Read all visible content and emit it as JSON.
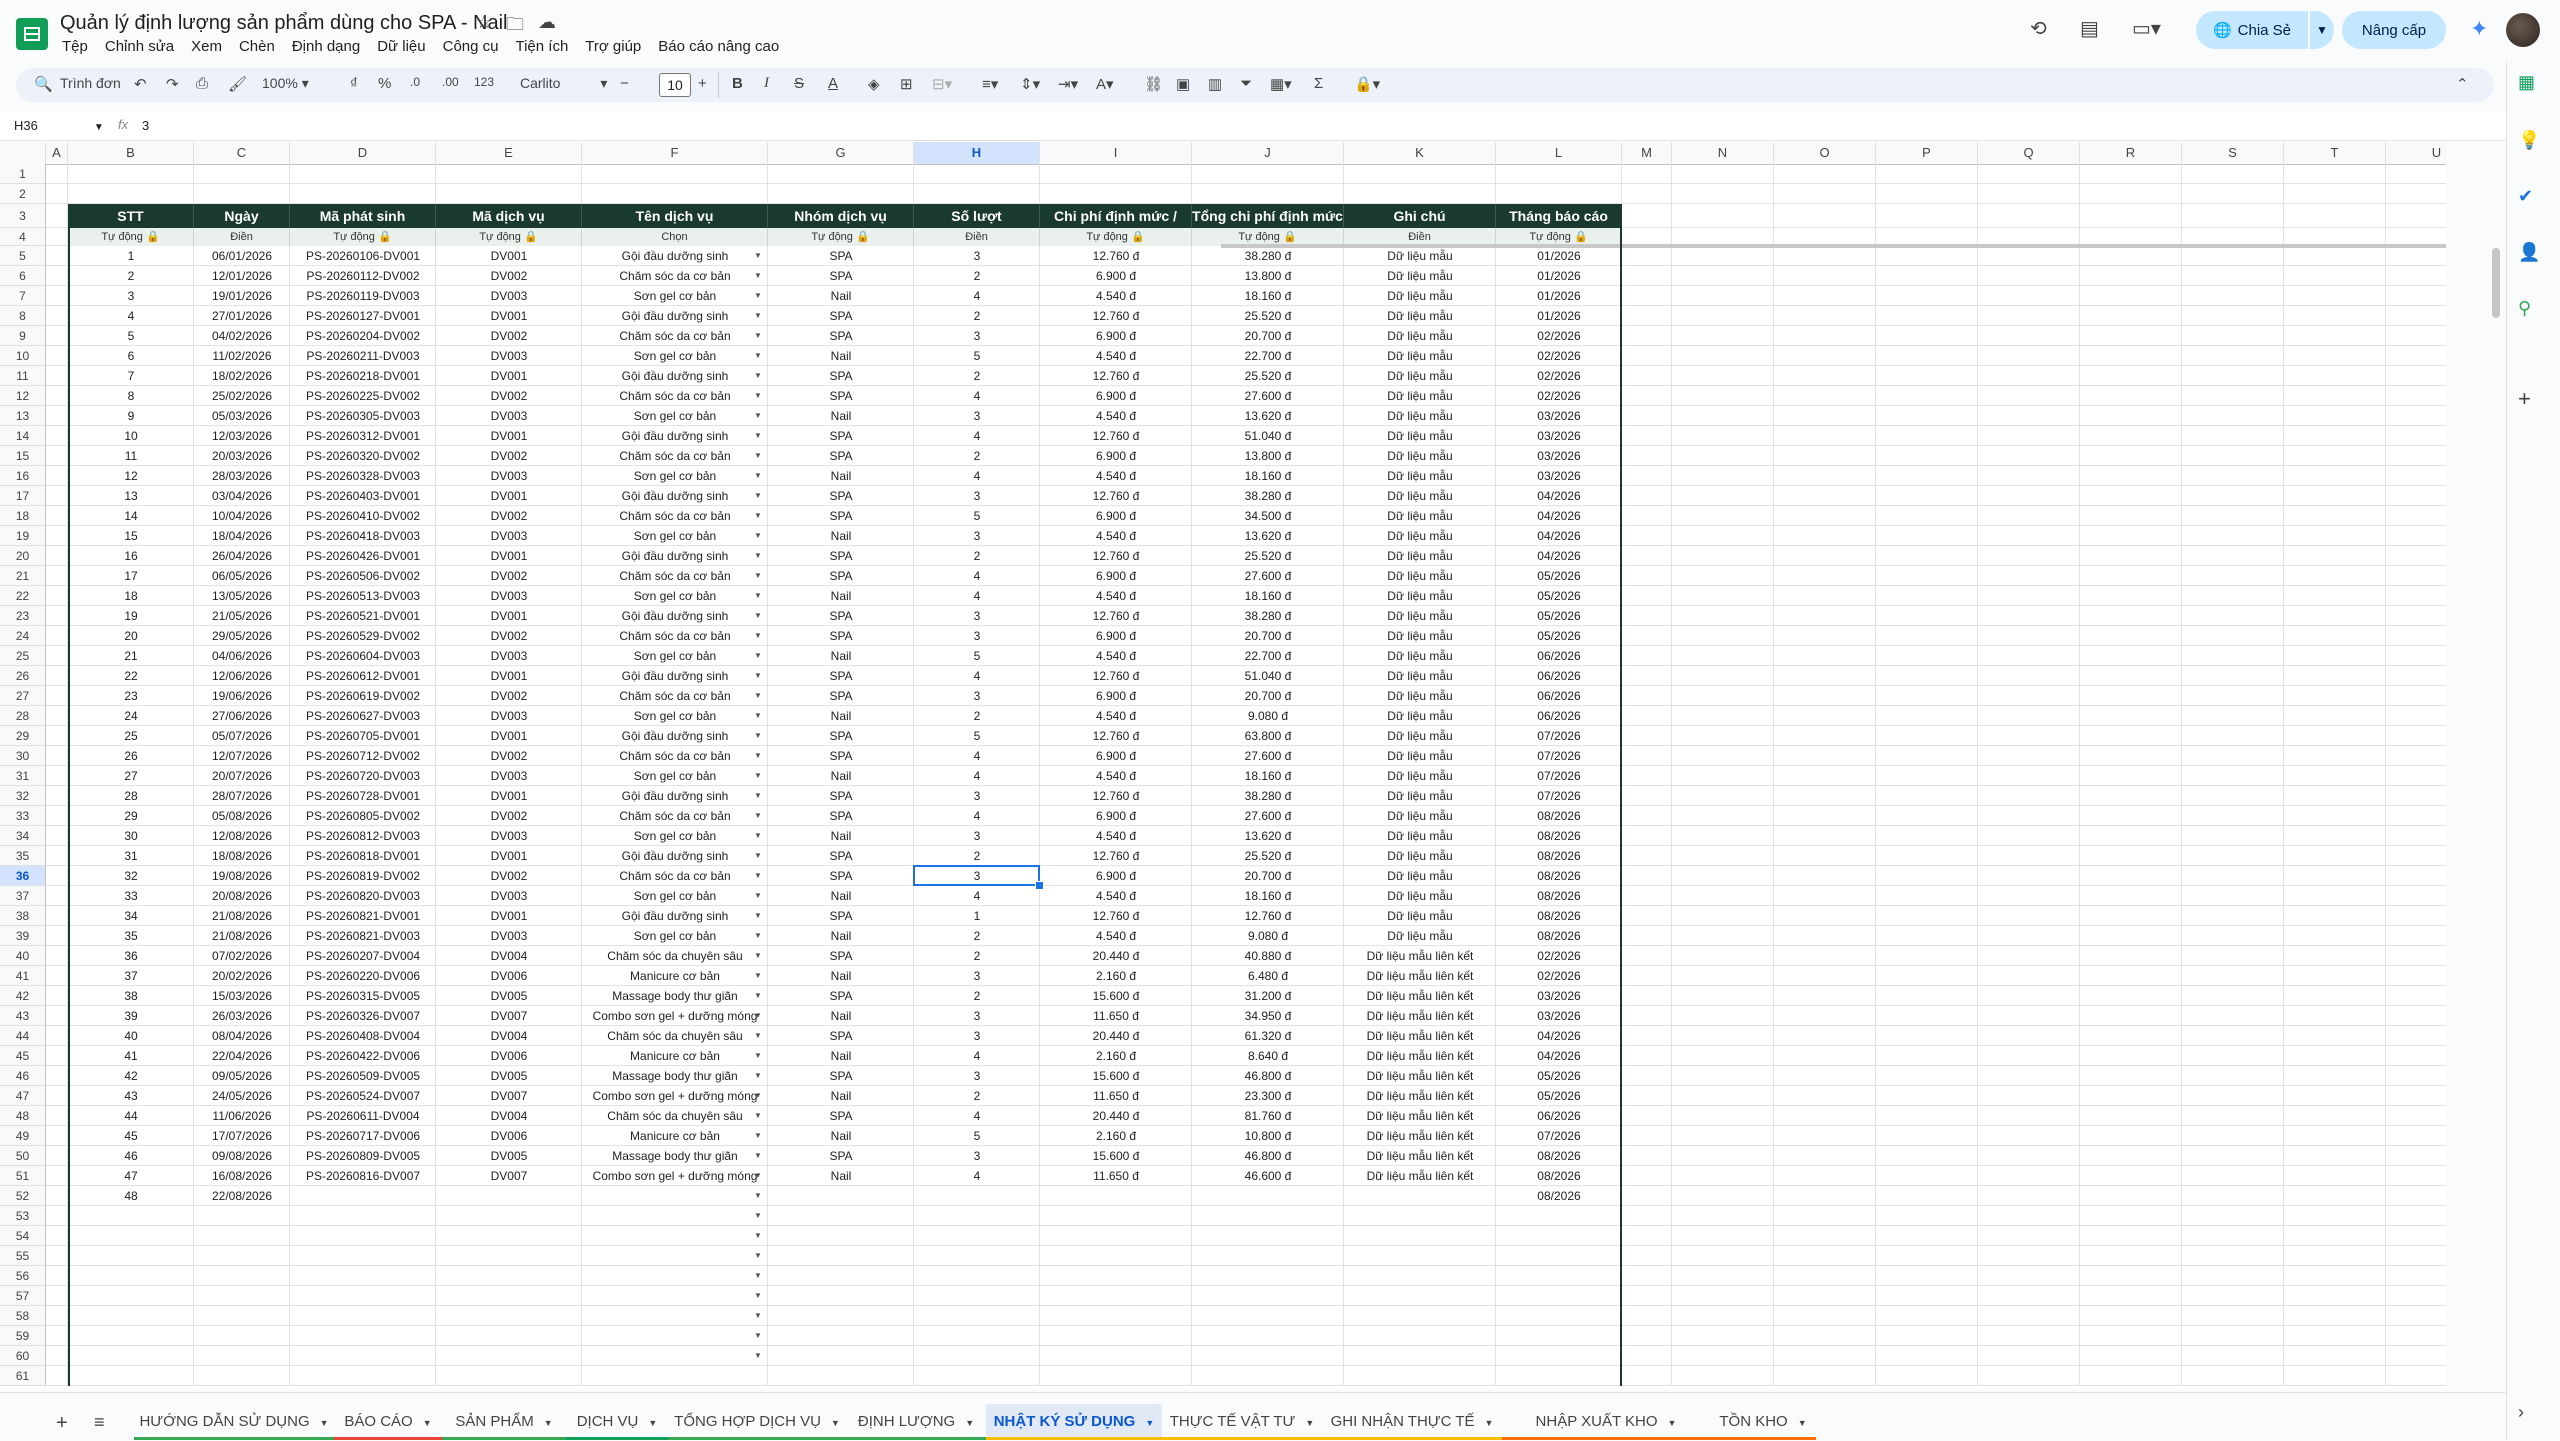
{
  "app": {
    "title": "Quản lý định lượng sản phẩm dùng cho SPA - Nail",
    "menus": [
      "Tệp",
      "Chỉnh sửa",
      "Xem",
      "Chèn",
      "Định dạng",
      "Dữ liệu",
      "Công cụ",
      "Tiện ích",
      "Trợ giúp",
      "Báo cáo nâng cao"
    ],
    "share_label": "Chia Sẻ",
    "upgrade_label": "Nâng cấp"
  },
  "toolbar": {
    "search_placeholder": "Trình đơn",
    "zoom": "100%",
    "currency": "₫",
    "percent": "%",
    "dec_minus": ".0",
    "dec_plus": ".00",
    "number_format": "123",
    "font": "Carlito",
    "font_size": "10"
  },
  "formula": {
    "cell_ref": "H36",
    "fx": "fx",
    "value": "3"
  },
  "columns": [
    "A",
    "B",
    "C",
    "D",
    "E",
    "F",
    "G",
    "H",
    "I",
    "J",
    "K",
    "L",
    "M",
    "N",
    "O",
    "P",
    "Q",
    "R",
    "S",
    "T",
    "U"
  ],
  "table": {
    "headers": [
      "STT",
      "Ngày",
      "Mã phát sinh",
      "Mã dịch vụ",
      "Tên dịch vụ",
      "Nhóm dịch vụ",
      "Số lượt",
      "Chi phí định mức / lượt",
      "Tổng chi phí định mức",
      "Ghi chú",
      "Tháng báo cáo"
    ],
    "subheaders": [
      "Tự động 🔒",
      "Điền",
      "Tự động 🔒",
      "Tự động 🔒",
      "Chọn",
      "Tự động 🔒",
      "Điền",
      "Tự động 🔒",
      "Tự động 🔒",
      "Điền",
      "Tự động 🔒"
    ],
    "rows": [
      [
        "1",
        "06/01/2026",
        "PS-20260106-DV001",
        "DV001",
        "Gội đầu dưỡng sinh",
        "SPA",
        "3",
        "12.760 đ",
        "38.280 đ",
        "Dữ liệu mẫu",
        "01/2026"
      ],
      [
        "2",
        "12/01/2026",
        "PS-20260112-DV002",
        "DV002",
        "Chăm sóc da cơ bản",
        "SPA",
        "2",
        "6.900 đ",
        "13.800 đ",
        "Dữ liệu mẫu",
        "01/2026"
      ],
      [
        "3",
        "19/01/2026",
        "PS-20260119-DV003",
        "DV003",
        "Sơn gel cơ bản",
        "Nail",
        "4",
        "4.540 đ",
        "18.160 đ",
        "Dữ liệu mẫu",
        "01/2026"
      ],
      [
        "4",
        "27/01/2026",
        "PS-20260127-DV001",
        "DV001",
        "Gội đầu dưỡng sinh",
        "SPA",
        "2",
        "12.760 đ",
        "25.520 đ",
        "Dữ liệu mẫu",
        "01/2026"
      ],
      [
        "5",
        "04/02/2026",
        "PS-20260204-DV002",
        "DV002",
        "Chăm sóc da cơ bản",
        "SPA",
        "3",
        "6.900 đ",
        "20.700 đ",
        "Dữ liệu mẫu",
        "02/2026"
      ],
      [
        "6",
        "11/02/2026",
        "PS-20260211-DV003",
        "DV003",
        "Sơn gel cơ bản",
        "Nail",
        "5",
        "4.540 đ",
        "22.700 đ",
        "Dữ liệu mẫu",
        "02/2026"
      ],
      [
        "7",
        "18/02/2026",
        "PS-20260218-DV001",
        "DV001",
        "Gội đầu dưỡng sinh",
        "SPA",
        "2",
        "12.760 đ",
        "25.520 đ",
        "Dữ liệu mẫu",
        "02/2026"
      ],
      [
        "8",
        "25/02/2026",
        "PS-20260225-DV002",
        "DV002",
        "Chăm sóc da cơ bản",
        "SPA",
        "4",
        "6.900 đ",
        "27.600 đ",
        "Dữ liệu mẫu",
        "02/2026"
      ],
      [
        "9",
        "05/03/2026",
        "PS-20260305-DV003",
        "DV003",
        "Sơn gel cơ bản",
        "Nail",
        "3",
        "4.540 đ",
        "13.620 đ",
        "Dữ liệu mẫu",
        "03/2026"
      ],
      [
        "10",
        "12/03/2026",
        "PS-20260312-DV001",
        "DV001",
        "Gội đầu dưỡng sinh",
        "SPA",
        "4",
        "12.760 đ",
        "51.040 đ",
        "Dữ liệu mẫu",
        "03/2026"
      ],
      [
        "11",
        "20/03/2026",
        "PS-20260320-DV002",
        "DV002",
        "Chăm sóc da cơ bản",
        "SPA",
        "2",
        "6.900 đ",
        "13.800 đ",
        "Dữ liệu mẫu",
        "03/2026"
      ],
      [
        "12",
        "28/03/2026",
        "PS-20260328-DV003",
        "DV003",
        "Sơn gel cơ bản",
        "Nail",
        "4",
        "4.540 đ",
        "18.160 đ",
        "Dữ liệu mẫu",
        "03/2026"
      ],
      [
        "13",
        "03/04/2026",
        "PS-20260403-DV001",
        "DV001",
        "Gội đầu dưỡng sinh",
        "SPA",
        "3",
        "12.760 đ",
        "38.280 đ",
        "Dữ liệu mẫu",
        "04/2026"
      ],
      [
        "14",
        "10/04/2026",
        "PS-20260410-DV002",
        "DV002",
        "Chăm sóc da cơ bản",
        "SPA",
        "5",
        "6.900 đ",
        "34.500 đ",
        "Dữ liệu mẫu",
        "04/2026"
      ],
      [
        "15",
        "18/04/2026",
        "PS-20260418-DV003",
        "DV003",
        "Sơn gel cơ bản",
        "Nail",
        "3",
        "4.540 đ",
        "13.620 đ",
        "Dữ liệu mẫu",
        "04/2026"
      ],
      [
        "16",
        "26/04/2026",
        "PS-20260426-DV001",
        "DV001",
        "Gội đầu dưỡng sinh",
        "SPA",
        "2",
        "12.760 đ",
        "25.520 đ",
        "Dữ liệu mẫu",
        "04/2026"
      ],
      [
        "17",
        "06/05/2026",
        "PS-20260506-DV002",
        "DV002",
        "Chăm sóc da cơ bản",
        "SPA",
        "4",
        "6.900 đ",
        "27.600 đ",
        "Dữ liệu mẫu",
        "05/2026"
      ],
      [
        "18",
        "13/05/2026",
        "PS-20260513-DV003",
        "DV003",
        "Sơn gel cơ bản",
        "Nail",
        "4",
        "4.540 đ",
        "18.160 đ",
        "Dữ liệu mẫu",
        "05/2026"
      ],
      [
        "19",
        "21/05/2026",
        "PS-20260521-DV001",
        "DV001",
        "Gội đầu dưỡng sinh",
        "SPA",
        "3",
        "12.760 đ",
        "38.280 đ",
        "Dữ liệu mẫu",
        "05/2026"
      ],
      [
        "20",
        "29/05/2026",
        "PS-20260529-DV002",
        "DV002",
        "Chăm sóc da cơ bản",
        "SPA",
        "3",
        "6.900 đ",
        "20.700 đ",
        "Dữ liệu mẫu",
        "05/2026"
      ],
      [
        "21",
        "04/06/2026",
        "PS-20260604-DV003",
        "DV003",
        "Sơn gel cơ bản",
        "Nail",
        "5",
        "4.540 đ",
        "22.700 đ",
        "Dữ liệu mẫu",
        "06/2026"
      ],
      [
        "22",
        "12/06/2026",
        "PS-20260612-DV001",
        "DV001",
        "Gội đầu dưỡng sinh",
        "SPA",
        "4",
        "12.760 đ",
        "51.040 đ",
        "Dữ liệu mẫu",
        "06/2026"
      ],
      [
        "23",
        "19/06/2026",
        "PS-20260619-DV002",
        "DV002",
        "Chăm sóc da cơ bản",
        "SPA",
        "3",
        "6.900 đ",
        "20.700 đ",
        "Dữ liệu mẫu",
        "06/2026"
      ],
      [
        "24",
        "27/06/2026",
        "PS-20260627-DV003",
        "DV003",
        "Sơn gel cơ bản",
        "Nail",
        "2",
        "4.540 đ",
        "9.080 đ",
        "Dữ liệu mẫu",
        "06/2026"
      ],
      [
        "25",
        "05/07/2026",
        "PS-20260705-DV001",
        "DV001",
        "Gội đầu dưỡng sinh",
        "SPA",
        "5",
        "12.760 đ",
        "63.800 đ",
        "Dữ liệu mẫu",
        "07/2026"
      ],
      [
        "26",
        "12/07/2026",
        "PS-20260712-DV002",
        "DV002",
        "Chăm sóc da cơ bản",
        "SPA",
        "4",
        "6.900 đ",
        "27.600 đ",
        "Dữ liệu mẫu",
        "07/2026"
      ],
      [
        "27",
        "20/07/2026",
        "PS-20260720-DV003",
        "DV003",
        "Sơn gel cơ bản",
        "Nail",
        "4",
        "4.540 đ",
        "18.160 đ",
        "Dữ liệu mẫu",
        "07/2026"
      ],
      [
        "28",
        "28/07/2026",
        "PS-20260728-DV001",
        "DV001",
        "Gội đầu dưỡng sinh",
        "SPA",
        "3",
        "12.760 đ",
        "38.280 đ",
        "Dữ liệu mẫu",
        "07/2026"
      ],
      [
        "29",
        "05/08/2026",
        "PS-20260805-DV002",
        "DV002",
        "Chăm sóc da cơ bản",
        "SPA",
        "4",
        "6.900 đ",
        "27.600 đ",
        "Dữ liệu mẫu",
        "08/2026"
      ],
      [
        "30",
        "12/08/2026",
        "PS-20260812-DV003",
        "DV003",
        "Sơn gel cơ bản",
        "Nail",
        "3",
        "4.540 đ",
        "13.620 đ",
        "Dữ liệu mẫu",
        "08/2026"
      ],
      [
        "31",
        "18/08/2026",
        "PS-20260818-DV001",
        "DV001",
        "Gội đầu dưỡng sinh",
        "SPA",
        "2",
        "12.760 đ",
        "25.520 đ",
        "Dữ liệu mẫu",
        "08/2026"
      ],
      [
        "32",
        "19/08/2026",
        "PS-20260819-DV002",
        "DV002",
        "Chăm sóc da cơ bản",
        "SPA",
        "3",
        "6.900 đ",
        "20.700 đ",
        "Dữ liệu mẫu",
        "08/2026"
      ],
      [
        "33",
        "20/08/2026",
        "PS-20260820-DV003",
        "DV003",
        "Sơn gel cơ bản",
        "Nail",
        "4",
        "4.540 đ",
        "18.160 đ",
        "Dữ liệu mẫu",
        "08/2026"
      ],
      [
        "34",
        "21/08/2026",
        "PS-20260821-DV001",
        "DV001",
        "Gội đầu dưỡng sinh",
        "SPA",
        "1",
        "12.760 đ",
        "12.760 đ",
        "Dữ liệu mẫu",
        "08/2026"
      ],
      [
        "35",
        "21/08/2026",
        "PS-20260821-DV003",
        "DV003",
        "Sơn gel cơ bản",
        "Nail",
        "2",
        "4.540 đ",
        "9.080 đ",
        "Dữ liệu mẫu",
        "08/2026"
      ],
      [
        "36",
        "07/02/2026",
        "PS-20260207-DV004",
        "DV004",
        "Chăm sóc da chuyên sâu",
        "SPA",
        "2",
        "20.440 đ",
        "40.880 đ",
        "Dữ liệu mẫu liên kết",
        "02/2026"
      ],
      [
        "37",
        "20/02/2026",
        "PS-20260220-DV006",
        "DV006",
        "Manicure cơ bản",
        "Nail",
        "3",
        "2.160 đ",
        "6.480 đ",
        "Dữ liệu mẫu liên kết",
        "02/2026"
      ],
      [
        "38",
        "15/03/2026",
        "PS-20260315-DV005",
        "DV005",
        "Massage body thư giãn",
        "SPA",
        "2",
        "15.600 đ",
        "31.200 đ",
        "Dữ liệu mẫu liên kết",
        "03/2026"
      ],
      [
        "39",
        "26/03/2026",
        "PS-20260326-DV007",
        "DV007",
        "Combo sơn gel + dưỡng móng",
        "Nail",
        "3",
        "11.650 đ",
        "34.950 đ",
        "Dữ liệu mẫu liên kết",
        "03/2026"
      ],
      [
        "40",
        "08/04/2026",
        "PS-20260408-DV004",
        "DV004",
        "Chăm sóc da chuyên sâu",
        "SPA",
        "3",
        "20.440 đ",
        "61.320 đ",
        "Dữ liệu mẫu liên kết",
        "04/2026"
      ],
      [
        "41",
        "22/04/2026",
        "PS-20260422-DV006",
        "DV006",
        "Manicure cơ bản",
        "Nail",
        "4",
        "2.160 đ",
        "8.640 đ",
        "Dữ liệu mẫu liên kết",
        "04/2026"
      ],
      [
        "42",
        "09/05/2026",
        "PS-20260509-DV005",
        "DV005",
        "Massage body thư giãn",
        "SPA",
        "3",
        "15.600 đ",
        "46.800 đ",
        "Dữ liệu mẫu liên kết",
        "05/2026"
      ],
      [
        "43",
        "24/05/2026",
        "PS-20260524-DV007",
        "DV007",
        "Combo sơn gel + dưỡng móng",
        "Nail",
        "2",
        "11.650 đ",
        "23.300 đ",
        "Dữ liệu mẫu liên kết",
        "05/2026"
      ],
      [
        "44",
        "11/06/2026",
        "PS-20260611-DV004",
        "DV004",
        "Chăm sóc da chuyên sâu",
        "SPA",
        "4",
        "20.440 đ",
        "81.760 đ",
        "Dữ liệu mẫu liên kết",
        "06/2026"
      ],
      [
        "45",
        "17/07/2026",
        "PS-20260717-DV006",
        "DV006",
        "Manicure cơ bản",
        "Nail",
        "5",
        "2.160 đ",
        "10.800 đ",
        "Dữ liệu mẫu liên kết",
        "07/2026"
      ],
      [
        "46",
        "09/08/2026",
        "PS-20260809-DV005",
        "DV005",
        "Massage body thư giãn",
        "SPA",
        "3",
        "15.600 đ",
        "46.800 đ",
        "Dữ liệu mẫu liên kết",
        "08/2026"
      ],
      [
        "47",
        "16/08/2026",
        "PS-20260816-DV007",
        "DV007",
        "Combo sơn gel + dưỡng móng",
        "Nail",
        "4",
        "11.650 đ",
        "46.600 đ",
        "Dữ liệu mẫu liên kết",
        "08/2026"
      ],
      [
        "48",
        "22/08/2026",
        "",
        "",
        "",
        "",
        "",
        "",
        "",
        "",
        "08/2026"
      ]
    ]
  },
  "sheets": [
    {
      "name": "HƯỚNG DẪN SỬ DỤNG",
      "color": "#34a853"
    },
    {
      "name": "BÁO CÁO",
      "color": "#ea4335"
    },
    {
      "name": "SẢN PHẨM",
      "color": "#34a853"
    },
    {
      "name": "DỊCH VỤ",
      "color": "#0f9d58"
    },
    {
      "name": "TỔNG HỢP DỊCH VỤ",
      "color": "#34a853"
    },
    {
      "name": "ĐỊNH LƯỢNG",
      "color": "#34a853"
    },
    {
      "name": "NHẬT KÝ SỬ DỤNG",
      "color": "#fbbc04",
      "active": true
    },
    {
      "name": "THỰC TẾ VẬT TƯ",
      "color": "#fbbc04"
    },
    {
      "name": "GHI NHẬN THỰC TẾ",
      "color": "#fbbc04"
    },
    {
      "name": "NHẬP XUẤT KHO",
      "color": "#ff6d01"
    },
    {
      "name": "TỒN KHO",
      "color": "#ff6d01"
    }
  ],
  "colors": {
    "header_bg": "#1b3a2f",
    "accent": "#0b57d0",
    "selection": "#1a73e8"
  },
  "selected_cell": {
    "col": "H",
    "row": 36
  }
}
